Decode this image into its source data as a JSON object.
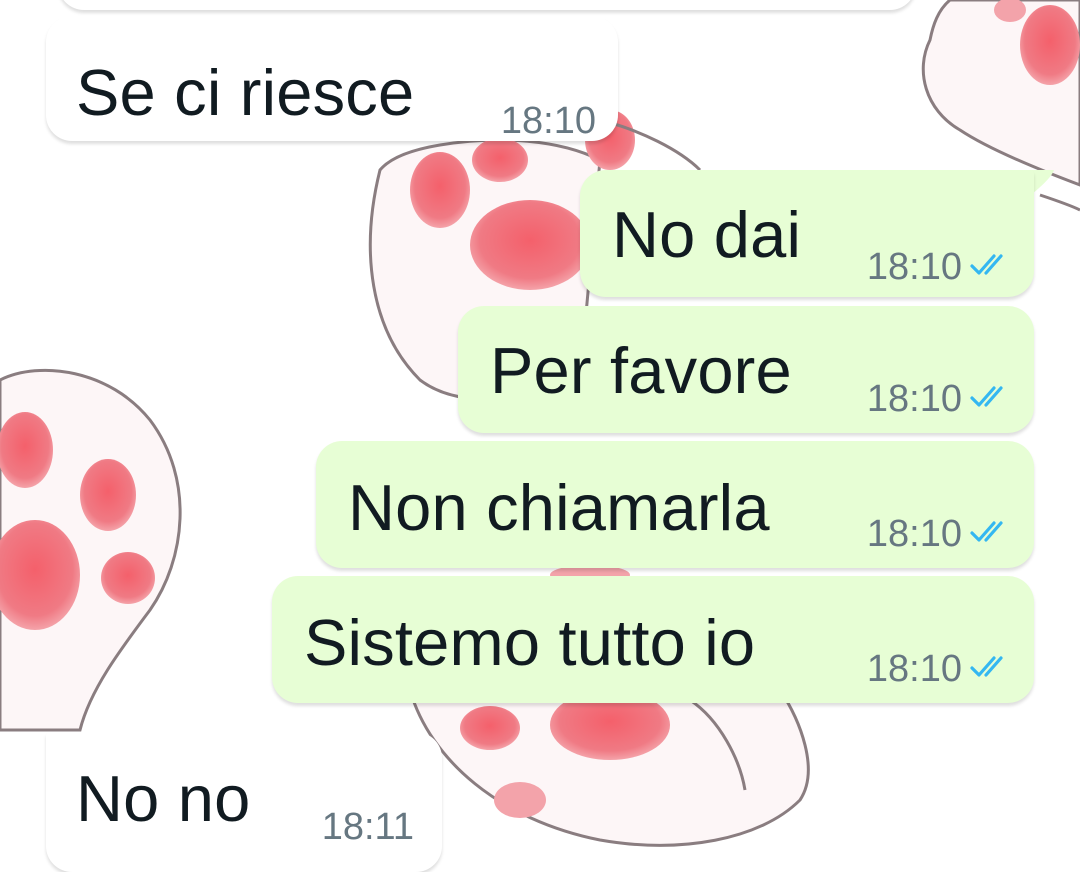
{
  "chat": {
    "colors": {
      "incoming_bubble": "#ffffff",
      "outgoing_bubble": "#e7fed5",
      "text": "#111b21",
      "timestamp": "#667781",
      "read_ticks": "#34b7f1"
    },
    "wallpaper": "cat-paw-pattern",
    "messages": [
      {
        "direction": "incoming",
        "text": "Se ci riesce",
        "time": "18:10"
      },
      {
        "direction": "outgoing",
        "text": "No dai",
        "time": "18:10",
        "status": "read"
      },
      {
        "direction": "outgoing",
        "text": "Per favore",
        "time": "18:10",
        "status": "read"
      },
      {
        "direction": "outgoing",
        "text": "Non chiamarla",
        "time": "18:10",
        "status": "read"
      },
      {
        "direction": "outgoing",
        "text": "Sistemo tutto io",
        "time": "18:10",
        "status": "read"
      },
      {
        "direction": "incoming",
        "text": "No no",
        "time": "18:11"
      }
    ]
  }
}
